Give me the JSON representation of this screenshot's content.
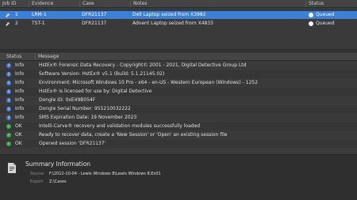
{
  "jobs": {
    "columns": [
      "Job ID",
      "Evidence",
      "Case",
      "Notes",
      "Status"
    ],
    "rows": [
      {
        "job_id": "1",
        "evidence": "LRM-1",
        "case": "DFR21137",
        "notes": "Dell Laptop seized from X3982",
        "status": "Queued",
        "selected": true
      },
      {
        "job_id": "2",
        "evidence": "TST-1",
        "case": "DFR21137",
        "notes": "Advent Laptop seized from X4833",
        "status": "Queued",
        "selected": false
      }
    ]
  },
  "log": {
    "columns": [
      "Status",
      "Message"
    ],
    "rows": [
      {
        "status": "Info",
        "type": "info",
        "message": "HstEx® Forensic Data Recovery - Copyright© 2001 - 2021, Digital Detective Group Ltd"
      },
      {
        "status": "Info",
        "type": "info",
        "message": "Software Version: HstEx® v5.1 (Build: 5.1.21145.02)"
      },
      {
        "status": "Info",
        "type": "info",
        "message": "Environment: Microsoft Windows 10 Pro - x64 - en-US - Western European (Windows) - 1252"
      },
      {
        "status": "Info",
        "type": "info",
        "message": "HstEx® is licensed for use by: Digital Detective"
      },
      {
        "status": "Info",
        "type": "info",
        "message": "Dongle ID: 0xE49B054F"
      },
      {
        "status": "Info",
        "type": "info",
        "message": "Dongle Serial Number: 955210032222"
      },
      {
        "status": "Info",
        "type": "info",
        "message": "SMS Expiration Date: 19 November 2023"
      },
      {
        "status": "OK",
        "type": "ok",
        "message": "Intelli-Carve® recovery and validation modules successfully loaded"
      },
      {
        "status": "OK",
        "type": "ok",
        "message": "Ready to recover data, create a 'New Session' or 'Open' an existing session file"
      },
      {
        "status": "OK",
        "type": "ok",
        "message": "Opened session 'DFR21137'"
      }
    ]
  },
  "summary": {
    "title": "Summary Information",
    "source_label": "Source",
    "source_value": "F:\\2012-10-04 - Lewis Windows 8\\Lewis Windows 8.Ex01",
    "export_label": "Export",
    "export_value": "Z:\\Cases"
  },
  "colors": {
    "selection": "#3b7fd6",
    "info": "#3d7fd8",
    "ok": "#37a74a",
    "background": "#3a3a3a"
  }
}
